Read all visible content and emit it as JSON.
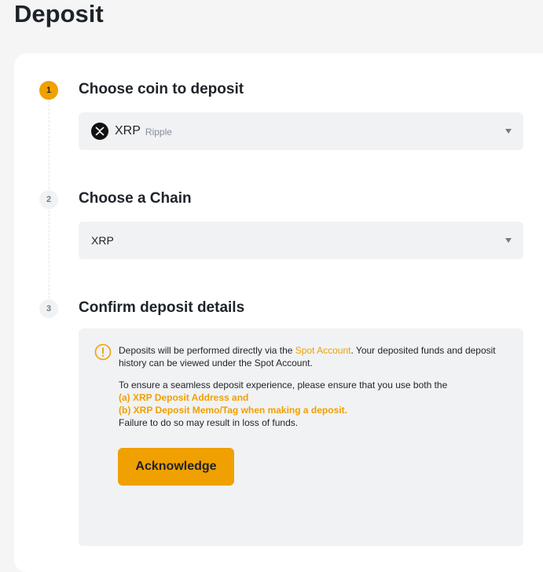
{
  "page": {
    "title": "Deposit"
  },
  "steps": [
    {
      "number": "1",
      "title": "Choose coin to deposit",
      "state": "active"
    },
    {
      "number": "2",
      "title": "Choose a Chain",
      "state": "inactive"
    },
    {
      "number": "3",
      "title": "Confirm deposit details",
      "state": "inactive"
    }
  ],
  "coin_select": {
    "symbol": "XRP",
    "name": "Ripple",
    "icon": "xrp-coin-icon"
  },
  "chain_select": {
    "value": "XRP"
  },
  "details": {
    "notice_prefix": "Deposits will be performed directly via the ",
    "notice_link": "Spot Account",
    "notice_suffix": ". Your deposited funds and deposit history can be viewed under the Spot Account.",
    "instructions_intro": "To ensure a seamless deposit experience, please ensure that you use both the",
    "requirement_a": "(a) XRP Deposit Address and",
    "requirement_b": "(b) XRP Deposit Memo/Tag when making a deposit.",
    "warning": "Failure to do so may result in loss of funds.",
    "acknowledge_label": "Acknowledge"
  },
  "colors": {
    "accent": "#f0a000",
    "background": "#f5f5f5",
    "card": "#ffffff",
    "field": "#f1f2f4",
    "text": "#1e2329",
    "muted": "#848e9c"
  }
}
